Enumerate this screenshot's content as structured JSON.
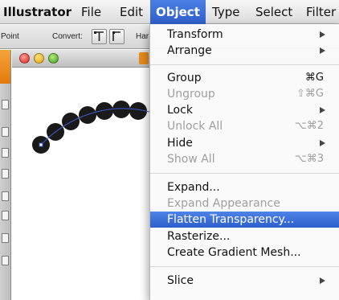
{
  "menubar": {
    "items": [
      {
        "label": "Illustrator"
      },
      {
        "label": "File"
      },
      {
        "label": "Edit"
      },
      {
        "label": "Object"
      },
      {
        "label": "Type"
      },
      {
        "label": "Select"
      },
      {
        "label": "Filter"
      }
    ]
  },
  "toolbar": {
    "point_label": "Point",
    "convert_label": "Convert:",
    "handles_label": "Har"
  },
  "menu": {
    "items": [
      {
        "label": "Transform",
        "submenu": true
      },
      {
        "label": "Arrange",
        "submenu": true
      },
      {
        "label": "Group",
        "shortcut": "⌘G"
      },
      {
        "label": "Ungroup",
        "shortcut": "⇧⌘G",
        "disabled": true
      },
      {
        "label": "Lock",
        "submenu": true
      },
      {
        "label": "Unlock All",
        "shortcut": "⌥⌘2",
        "disabled": true
      },
      {
        "label": "Hide",
        "submenu": true
      },
      {
        "label": "Show All",
        "shortcut": "⌥⌘3",
        "disabled": true
      },
      {
        "label": "Expand..."
      },
      {
        "label": "Expand Appearance",
        "disabled": true
      },
      {
        "label": "Flatten Transparency...",
        "highlighted": true
      },
      {
        "label": "Rasterize..."
      },
      {
        "label": "Create Gradient Mesh..."
      },
      {
        "label": "Slice",
        "submenu": true
      }
    ]
  },
  "colors": {
    "menu_highlight": "#3a6fd8",
    "path_dots": "#1a1a1a",
    "path_line": "#3a5bd0"
  }
}
